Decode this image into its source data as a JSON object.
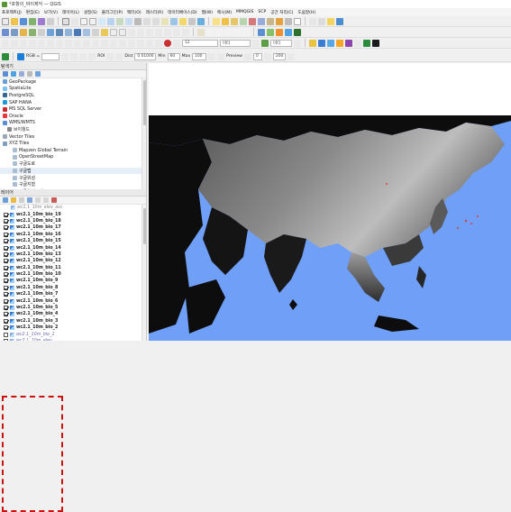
{
  "window": {
    "title": "*포항의_바이제익 — QGIS"
  },
  "menu": [
    "프로젝트(J)",
    "편집(E)",
    "보기(V)",
    "레이어(L)",
    "설정(S)",
    "플러그인(P)",
    "벡터(O)",
    "래스터(R)",
    "데이터베이스(D)",
    "웹(W)",
    "메시(M)",
    "MMQGIS",
    "SCP",
    "공간 처리(C)",
    "도움말(H)"
  ],
  "toolbar3": {
    "zoom_value": "12",
    "unit": "미터",
    "unit2": "미터"
  },
  "toolbar_scp": {
    "rgb_label": "RGB =",
    "roi_label": "ROI",
    "dist_label": "Dist",
    "dist_value": "0.01000",
    "min_label": "Min",
    "min_value": "60",
    "max_label": "Max",
    "max_value": "100",
    "preview_label": "Preview",
    "t_value": "0",
    "s_value": "200"
  },
  "browser_panel": {
    "title": "탐색기",
    "items": [
      {
        "label": "GeoPackage",
        "icon": "geopackage-icon"
      },
      {
        "label": "SpatiaLite",
        "icon": "spatialite-icon"
      },
      {
        "label": "PostgreSQL",
        "icon": "postgresql-icon"
      },
      {
        "label": "SAP HANA",
        "icon": "sap-hana-icon"
      },
      {
        "label": "MS SQL Server",
        "icon": "mssql-icon"
      },
      {
        "label": "Oracle",
        "icon": "oracle-icon"
      },
      {
        "label": "WMS/WMTS",
        "icon": "wms-icon"
      },
      {
        "label": "브이월드",
        "icon": "vworld-icon"
      },
      {
        "label": "Vector Tiles",
        "icon": "vector-tiles-icon"
      },
      {
        "label": "XYZ Tiles",
        "icon": "xyz-tiles-icon"
      },
      {
        "label": "Mapzen Global Terrain",
        "icon": "tile-icon"
      },
      {
        "label": "OpenStreetMap",
        "icon": "tile-icon"
      },
      {
        "label": "구글도로",
        "icon": "tile-icon"
      },
      {
        "label": "구글맵",
        "icon": "tile-icon"
      },
      {
        "label": "구글위성",
        "icon": "tile-icon"
      },
      {
        "label": "구글지형",
        "icon": "tile-icon"
      },
      {
        "label": "구글하이브리드",
        "icon": "tile-icon"
      }
    ]
  },
  "layers_panel": {
    "title": "레이어",
    "top_item": "wc2.1_10m_elev_asc",
    "layers": [
      "wc2.1_10m_bio_19",
      "wc2.1_10m_bio_18",
      "wc2.1_10m_bio_17",
      "wc2.1_10m_bio_16",
      "wc2.1_10m_bio_15",
      "wc2.1_10m_bio_14",
      "wc2.1_10m_bio_13",
      "wc2.1_10m_bio_12",
      "wc2.1_10m_bio_11",
      "wc2.1_10m_bio_10",
      "wc2.1_10m_bio_9",
      "wc2.1_10m_bio_8",
      "wc2.1_10m_bio_7",
      "wc2.1_10m_bio_6",
      "wc2.1_10m_bio_5",
      "wc2.1_10m_bio_4",
      "wc2.1_10m_bio_3",
      "wc2.1_10m_bio_2"
    ],
    "bottom_items": [
      "wc2.1_10m_bio_1",
      "wc2.1_10m_elev"
    ]
  },
  "colors": {
    "ocean": "#6f9ff7",
    "land_dark": "#0d0d0d",
    "highlight": "#cc1111",
    "qgis_green": "#589632"
  }
}
